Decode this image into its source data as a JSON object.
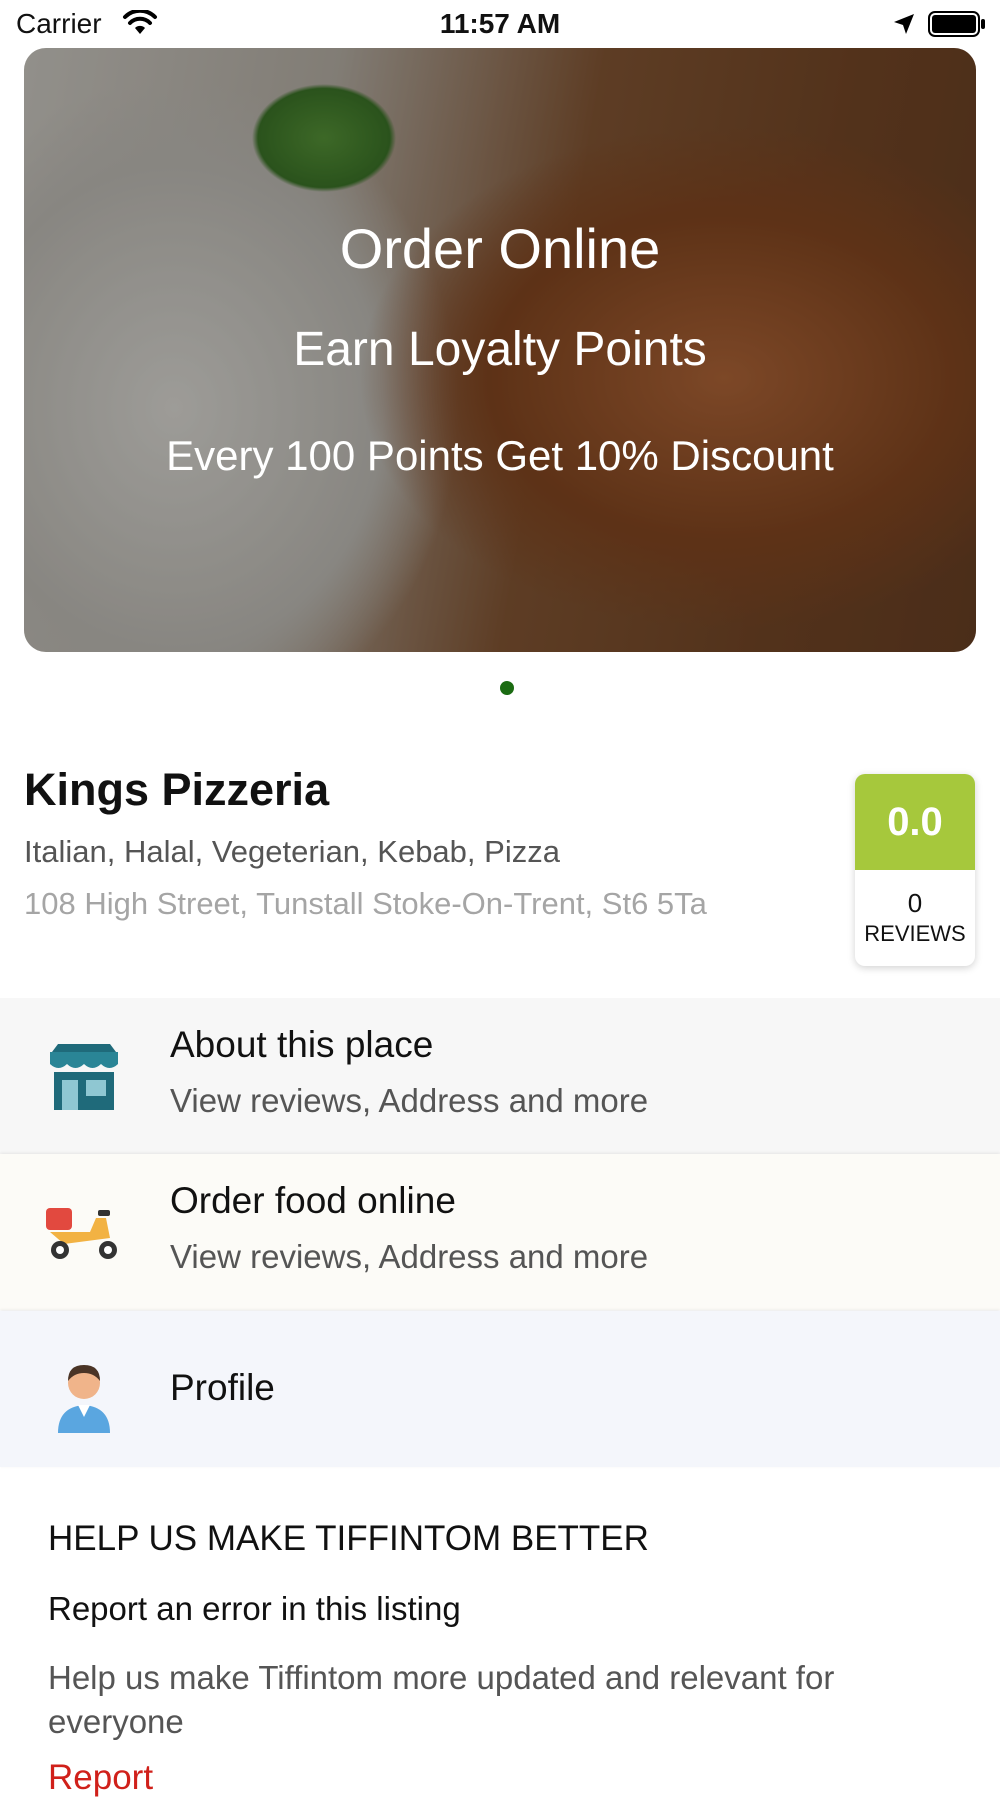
{
  "status_bar": {
    "carrier": "Carrier",
    "time": "11:57 AM"
  },
  "hero": {
    "line1": "Order Online",
    "line2": "Earn Loyalty Points",
    "line3": "Every 100 Points Get 10% Discount",
    "page_index": 1,
    "page_count": 1
  },
  "restaurant": {
    "name": "Kings Pizzeria",
    "cuisines": "Italian, Halal, Vegeterian, Kebab, Pizza",
    "address": "108 High Street, Tunstall Stoke-On-Trent, St6 5Ta",
    "rating": "0.0",
    "review_count": "0",
    "reviews_label": "REVIEWS",
    "rating_color": "#a6c83c"
  },
  "menu": {
    "about": {
      "title": "About this place",
      "subtitle": "View reviews, Address and more",
      "icon": "store-icon"
    },
    "order": {
      "title": "Order food online",
      "subtitle": "View reviews, Address and more",
      "icon": "scooter-icon"
    },
    "profile": {
      "title": "Profile",
      "icon": "user-avatar-icon"
    }
  },
  "help": {
    "heading": "HELP US MAKE TIFFINTOM BETTER",
    "report_title": "Report an error in this listing",
    "description": "Help us make Tiffintom more updated and relevant for everyone",
    "report_link": "Report"
  }
}
